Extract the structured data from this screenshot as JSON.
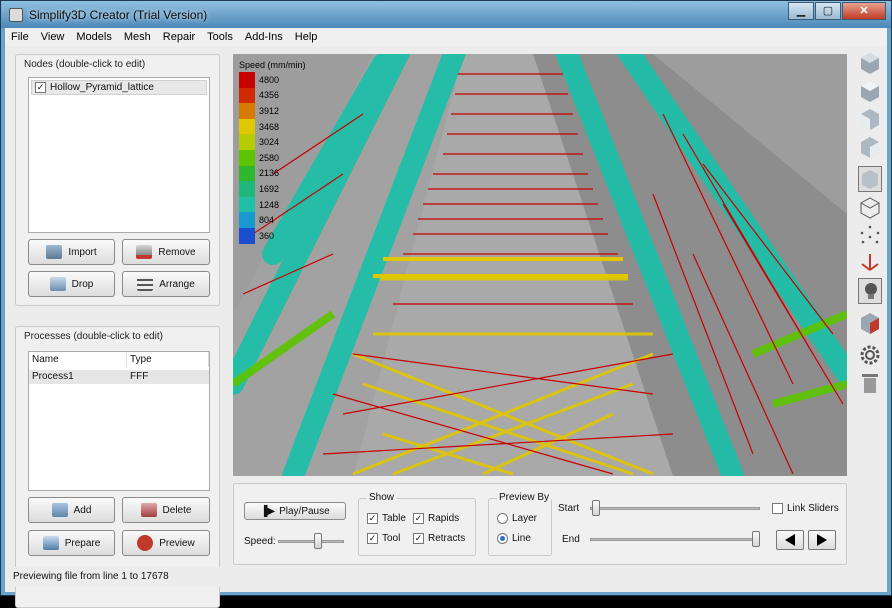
{
  "window": {
    "title": "Simplify3D Creator (Trial Version)",
    "minimize": "▁",
    "maximize": "▢",
    "close": "✕"
  },
  "menu": [
    "File",
    "View",
    "Models",
    "Mesh",
    "Repair",
    "Tools",
    "Add-Ins",
    "Help"
  ],
  "nodes": {
    "title": "Nodes (double-click to edit)",
    "items": [
      {
        "label": "Hollow_Pyramid_lattice",
        "checked": "✓"
      }
    ],
    "buttons": {
      "import": "Import",
      "remove": "Remove",
      "drop": "Drop",
      "arrange": "Arrange"
    }
  },
  "processes": {
    "title": "Processes (double-click to edit)",
    "columns": [
      "Name",
      "Type"
    ],
    "rows": [
      {
        "name": "Process1",
        "type": "FFF"
      }
    ],
    "buttons": {
      "add": "Add",
      "delete": "Delete",
      "prepare": "Prepare",
      "preview": "Preview"
    }
  },
  "legend": {
    "title": "Speed (mm/min)",
    "entries": [
      {
        "value": "4800",
        "color": "#c80000"
      },
      {
        "value": "4356",
        "color": "#d22a00"
      },
      {
        "value": "3912",
        "color": "#d67a00"
      },
      {
        "value": "3468",
        "color": "#e0c800"
      },
      {
        "value": "3024",
        "color": "#b4cc00"
      },
      {
        "value": "2580",
        "color": "#5cc400"
      },
      {
        "value": "2136",
        "color": "#2eb82e"
      },
      {
        "value": "1692",
        "color": "#1fb87a"
      },
      {
        "value": "1248",
        "color": "#1fbfa8"
      },
      {
        "value": "804",
        "color": "#1a98d0"
      },
      {
        "value": "360",
        "color": "#1a4fd0"
      }
    ]
  },
  "controls": {
    "play_pause": "Play/Pause",
    "speed_label": "Speed:",
    "show": {
      "title": "Show",
      "table": "Table",
      "rapids": "Rapids",
      "tool": "Tool",
      "retracts": "Retracts",
      "check": "✓"
    },
    "preview_by": {
      "title": "Preview By",
      "layer": "Layer",
      "line": "Line"
    },
    "start_label": "Start",
    "end_label": "End",
    "link_sliders": "Link Sliders"
  },
  "status": "Previewing file from line 1 to 17678",
  "tools": [
    "view-iso-icon",
    "view-top-icon",
    "view-front-icon",
    "view-side-icon",
    "solid-view-icon",
    "wireframe-view-icon",
    "point-view-icon",
    "axes-icon",
    "lightbulb-icon",
    "cross-section-icon",
    "settings-gear-icon",
    "trash-icon"
  ]
}
